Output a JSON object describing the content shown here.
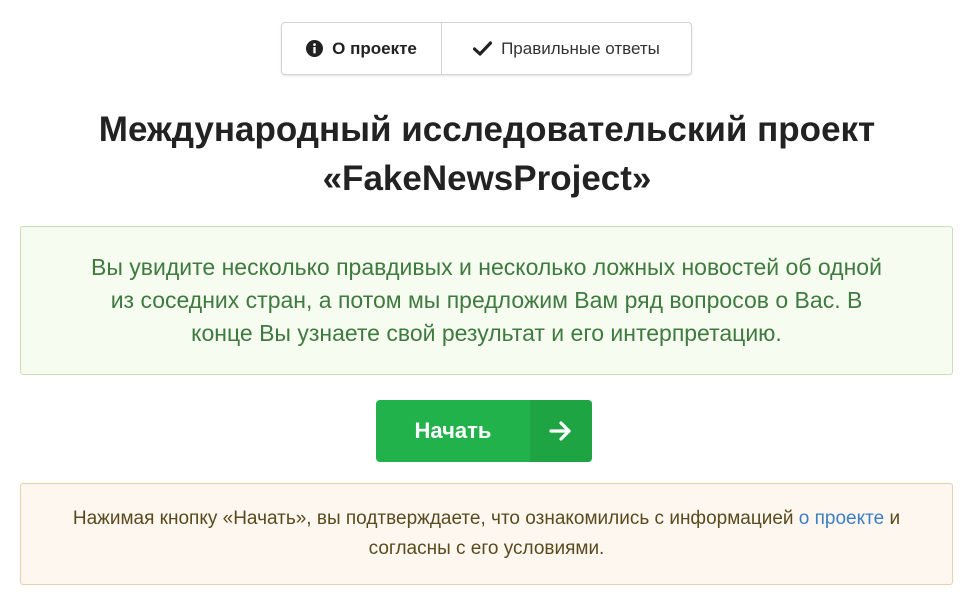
{
  "tabs": {
    "about": {
      "label": "О проекте",
      "icon": "info-circle-icon"
    },
    "answers": {
      "label": "Правильные ответы",
      "icon": "check-icon"
    }
  },
  "title": {
    "line1": "Международный исследовательский проект",
    "line2": "«FakeNewsProject»"
  },
  "info": {
    "text": "Вы увидите несколько правдивых и несколько ложных новостей об одной из соседних стран, а потом мы предложим Вам ряд вопросов о Вас. В конце Вы узнаете свой результат и его интерпретацию."
  },
  "start_button": {
    "label": "Начать",
    "icon": "arrow-right-icon"
  },
  "consent": {
    "text_before": "Нажимая кнопку «Начать», вы подтверждаете, что ознакомились с информацией ",
    "link_text": "о проекте",
    "text_after": " и согласны с его условиями."
  },
  "colors": {
    "button_green": "#22b24c",
    "info_text": "#3f7a3f",
    "link": "#3d7ec5"
  }
}
